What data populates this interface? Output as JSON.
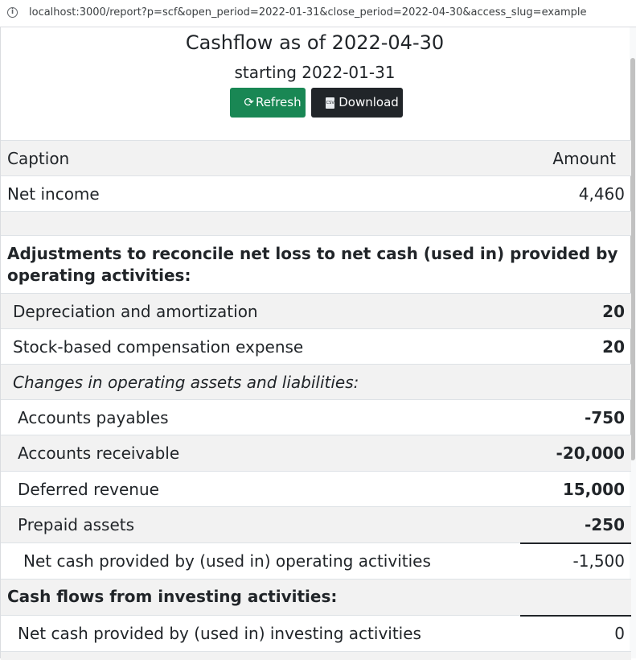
{
  "browser": {
    "url": "localhost:3000/report?p=scf&open_period=2022-01-31&close_period=2022-04-30&access_slug=example"
  },
  "report": {
    "title": "Cashflow as of 2022-04-30",
    "subtitle": "starting 2022-01-31",
    "refresh_label": "Refresh",
    "download_label": "Download"
  },
  "table": {
    "headers": {
      "caption": "Caption",
      "amount": "Amount"
    },
    "rows": [
      {
        "caption": "Net income",
        "amount": "4,460"
      },
      {
        "caption": "",
        "amount": ""
      },
      {
        "caption": "Adjustments to reconcile net loss to net cash (used in) provided by operating activities:",
        "amount": ""
      },
      {
        "caption": "Depreciation and amortization",
        "amount": "20"
      },
      {
        "caption": "Stock-based compensation expense",
        "amount": "20"
      },
      {
        "caption": "Changes in operating assets and liabilities:",
        "amount": ""
      },
      {
        "caption": "Accounts payables",
        "amount": "-750"
      },
      {
        "caption": "Accounts receivable",
        "amount": "-20,000"
      },
      {
        "caption": "Deferred revenue",
        "amount": "15,000"
      },
      {
        "caption": "Prepaid assets",
        "amount": "-250"
      },
      {
        "caption": "Net cash provided by (used in) operating activities",
        "amount": "-1,500"
      },
      {
        "caption": "Cash flows from investing activities:",
        "amount": ""
      },
      {
        "caption": "Net cash provided by (used in) investing activities",
        "amount": "0"
      }
    ]
  },
  "colors": {
    "refresh_button": "#198754",
    "download_button": "#212529",
    "stripe": "#f2f2f2"
  }
}
